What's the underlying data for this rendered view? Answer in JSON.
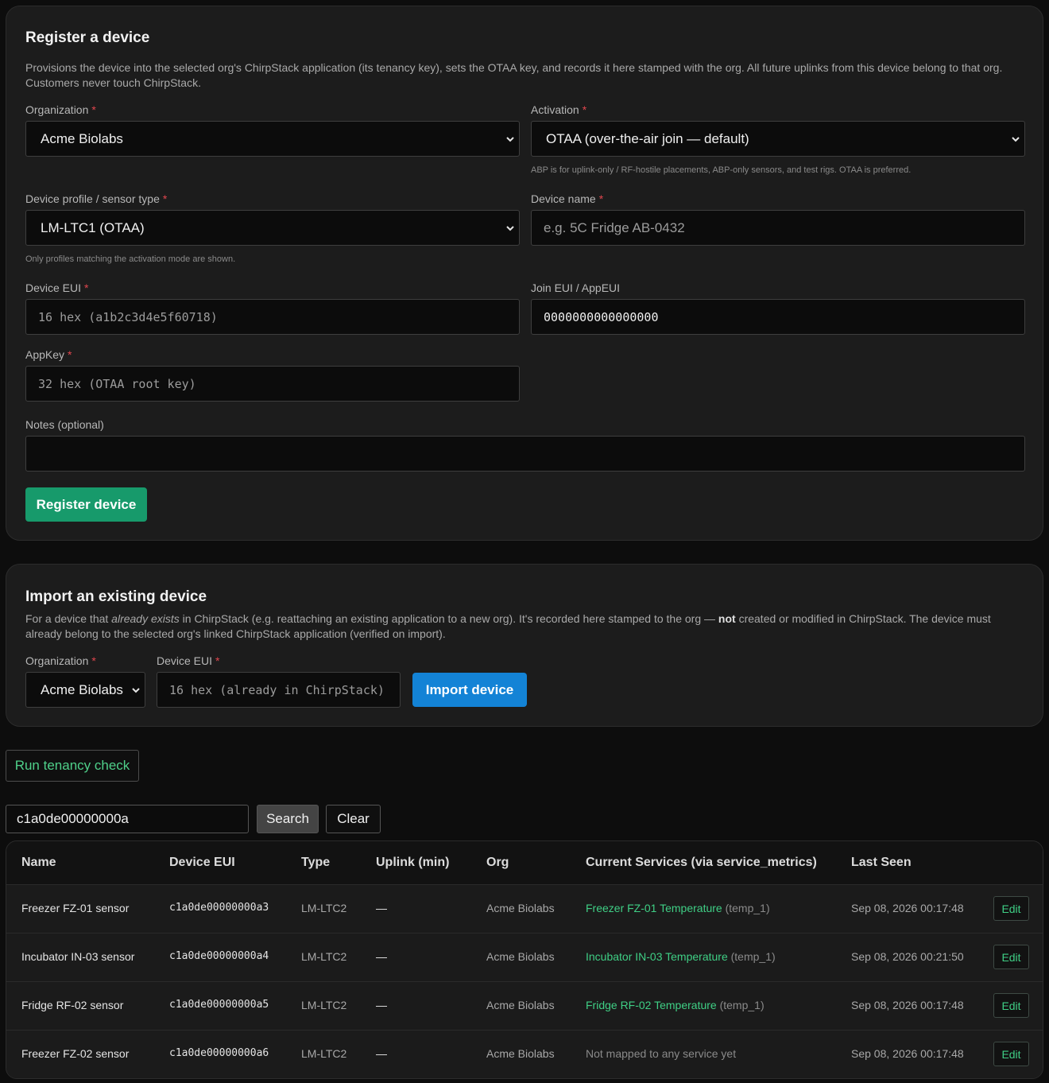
{
  "register": {
    "title": "Register a device",
    "description": "Provisions the device into the selected org's ChirpStack application (its tenancy key), sets the OTAA key, and records it here stamped with the org. All future uplinks from this device belong to that org. Customers never touch ChirpStack.",
    "organization": {
      "label": "Organization",
      "value": "Acme Biolabs"
    },
    "activation": {
      "label": "Activation",
      "value": "OTAA (over-the-air join — default)",
      "hint": "ABP is for uplink-only / RF-hostile placements, ABP-only sensors, and test rigs. OTAA is preferred."
    },
    "device_profile": {
      "label": "Device profile / sensor type",
      "value": "LM-LTC1 (OTAA)",
      "hint": "Only profiles matching the activation mode are shown."
    },
    "device_name": {
      "label": "Device name",
      "placeholder": "e.g. 5C Fridge AB-0432"
    },
    "device_eui": {
      "label": "Device EUI",
      "placeholder": "16 hex (a1b2c3d4e5f60718)"
    },
    "join_eui": {
      "label": "Join EUI / AppEUI",
      "value": "0000000000000000"
    },
    "appkey": {
      "label": "AppKey",
      "placeholder": "32 hex (OTAA root key)"
    },
    "notes": {
      "label": "Notes (optional)",
      "value": ""
    },
    "required_mark": "*",
    "submit_label": "Register device"
  },
  "import": {
    "title": "Import an existing device",
    "desc_pre": "For a device that ",
    "desc_em": "already exists",
    "desc_mid": " in ChirpStack (e.g. reattaching an existing application to a new org). It's recorded here stamped to the org — ",
    "desc_bold": "not",
    "desc_post": " created or modified in ChirpStack. The device must already belong to the selected org's linked ChirpStack application (verified on import).",
    "organization": {
      "label": "Organization",
      "value": "Acme Biolabs"
    },
    "device_eui": {
      "label": "Device EUI",
      "placeholder": "16 hex (already in ChirpStack)"
    },
    "submit_label": "Import device"
  },
  "tenancy_check_label": "Run tenancy check",
  "search": {
    "value": "c1a0de00000000a",
    "search_label": "Search",
    "clear_label": "Clear"
  },
  "table": {
    "columns": [
      "Name",
      "Device EUI",
      "Type",
      "Uplink (min)",
      "Org",
      "Current Services (via service_metrics)",
      "Last Seen"
    ],
    "edit_label": "Edit",
    "rows": [
      {
        "name": "Freezer FZ-01 sensor",
        "eui": "c1a0de00000000a3",
        "type": "LM-LTC2",
        "uplink": "—",
        "org": "Acme Biolabs",
        "service": "Freezer FZ-01 Temperature",
        "service_key": "(temp_1)",
        "last_seen": "Sep 08, 2026 00:17:48"
      },
      {
        "name": "Incubator IN-03 sensor",
        "eui": "c1a0de00000000a4",
        "type": "LM-LTC2",
        "uplink": "—",
        "org": "Acme Biolabs",
        "service": "Incubator IN-03 Temperature",
        "service_key": "(temp_1)",
        "last_seen": "Sep 08, 2026 00:21:50"
      },
      {
        "name": "Fridge RF-02 sensor",
        "eui": "c1a0de00000000a5",
        "type": "LM-LTC2",
        "uplink": "—",
        "org": "Acme Biolabs",
        "service": "Fridge RF-02 Temperature",
        "service_key": "(temp_1)",
        "last_seen": "Sep 08, 2026 00:17:48"
      },
      {
        "name": "Freezer FZ-02 sensor",
        "eui": "c1a0de00000000a6",
        "type": "LM-LTC2",
        "uplink": "—",
        "org": "Acme Biolabs",
        "unmapped": "Not mapped to any service yet",
        "last_seen": "Sep 08, 2026 00:17:48"
      }
    ]
  }
}
